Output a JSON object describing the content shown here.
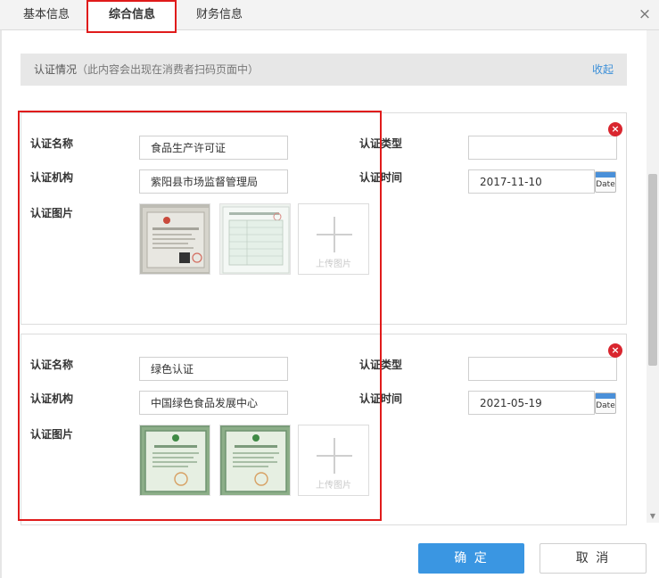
{
  "tabs": [
    {
      "label": "基本信息",
      "active": false
    },
    {
      "label": "综合信息",
      "active": true
    },
    {
      "label": "财务信息",
      "active": false
    }
  ],
  "close_icon": "×",
  "section": {
    "title": "认证情况",
    "note": "（此内容会出现在消费者扫码页面中）",
    "collapse": "收起"
  },
  "labels": {
    "name": "认证名称",
    "type": "认证类型",
    "org": "认证机构",
    "time": "认证时间",
    "images": "认证图片",
    "upload": "上传图片",
    "date_btn": "Date"
  },
  "certs": [
    {
      "name": "食品生产许可证",
      "type": "",
      "org": "紫阳县市场监督管理局",
      "date": "2017-11-10"
    },
    {
      "name": "绿色认证",
      "type": "",
      "org": "中国绿色食品发展中心",
      "date": "2021-05-19"
    }
  ],
  "footer": {
    "ok": "确 定",
    "cancel": "取 消"
  },
  "colors": {
    "primary": "#3a96e2",
    "highlight": "#e01b1b",
    "delete": "#d9262f",
    "link": "#3b8fd8"
  }
}
